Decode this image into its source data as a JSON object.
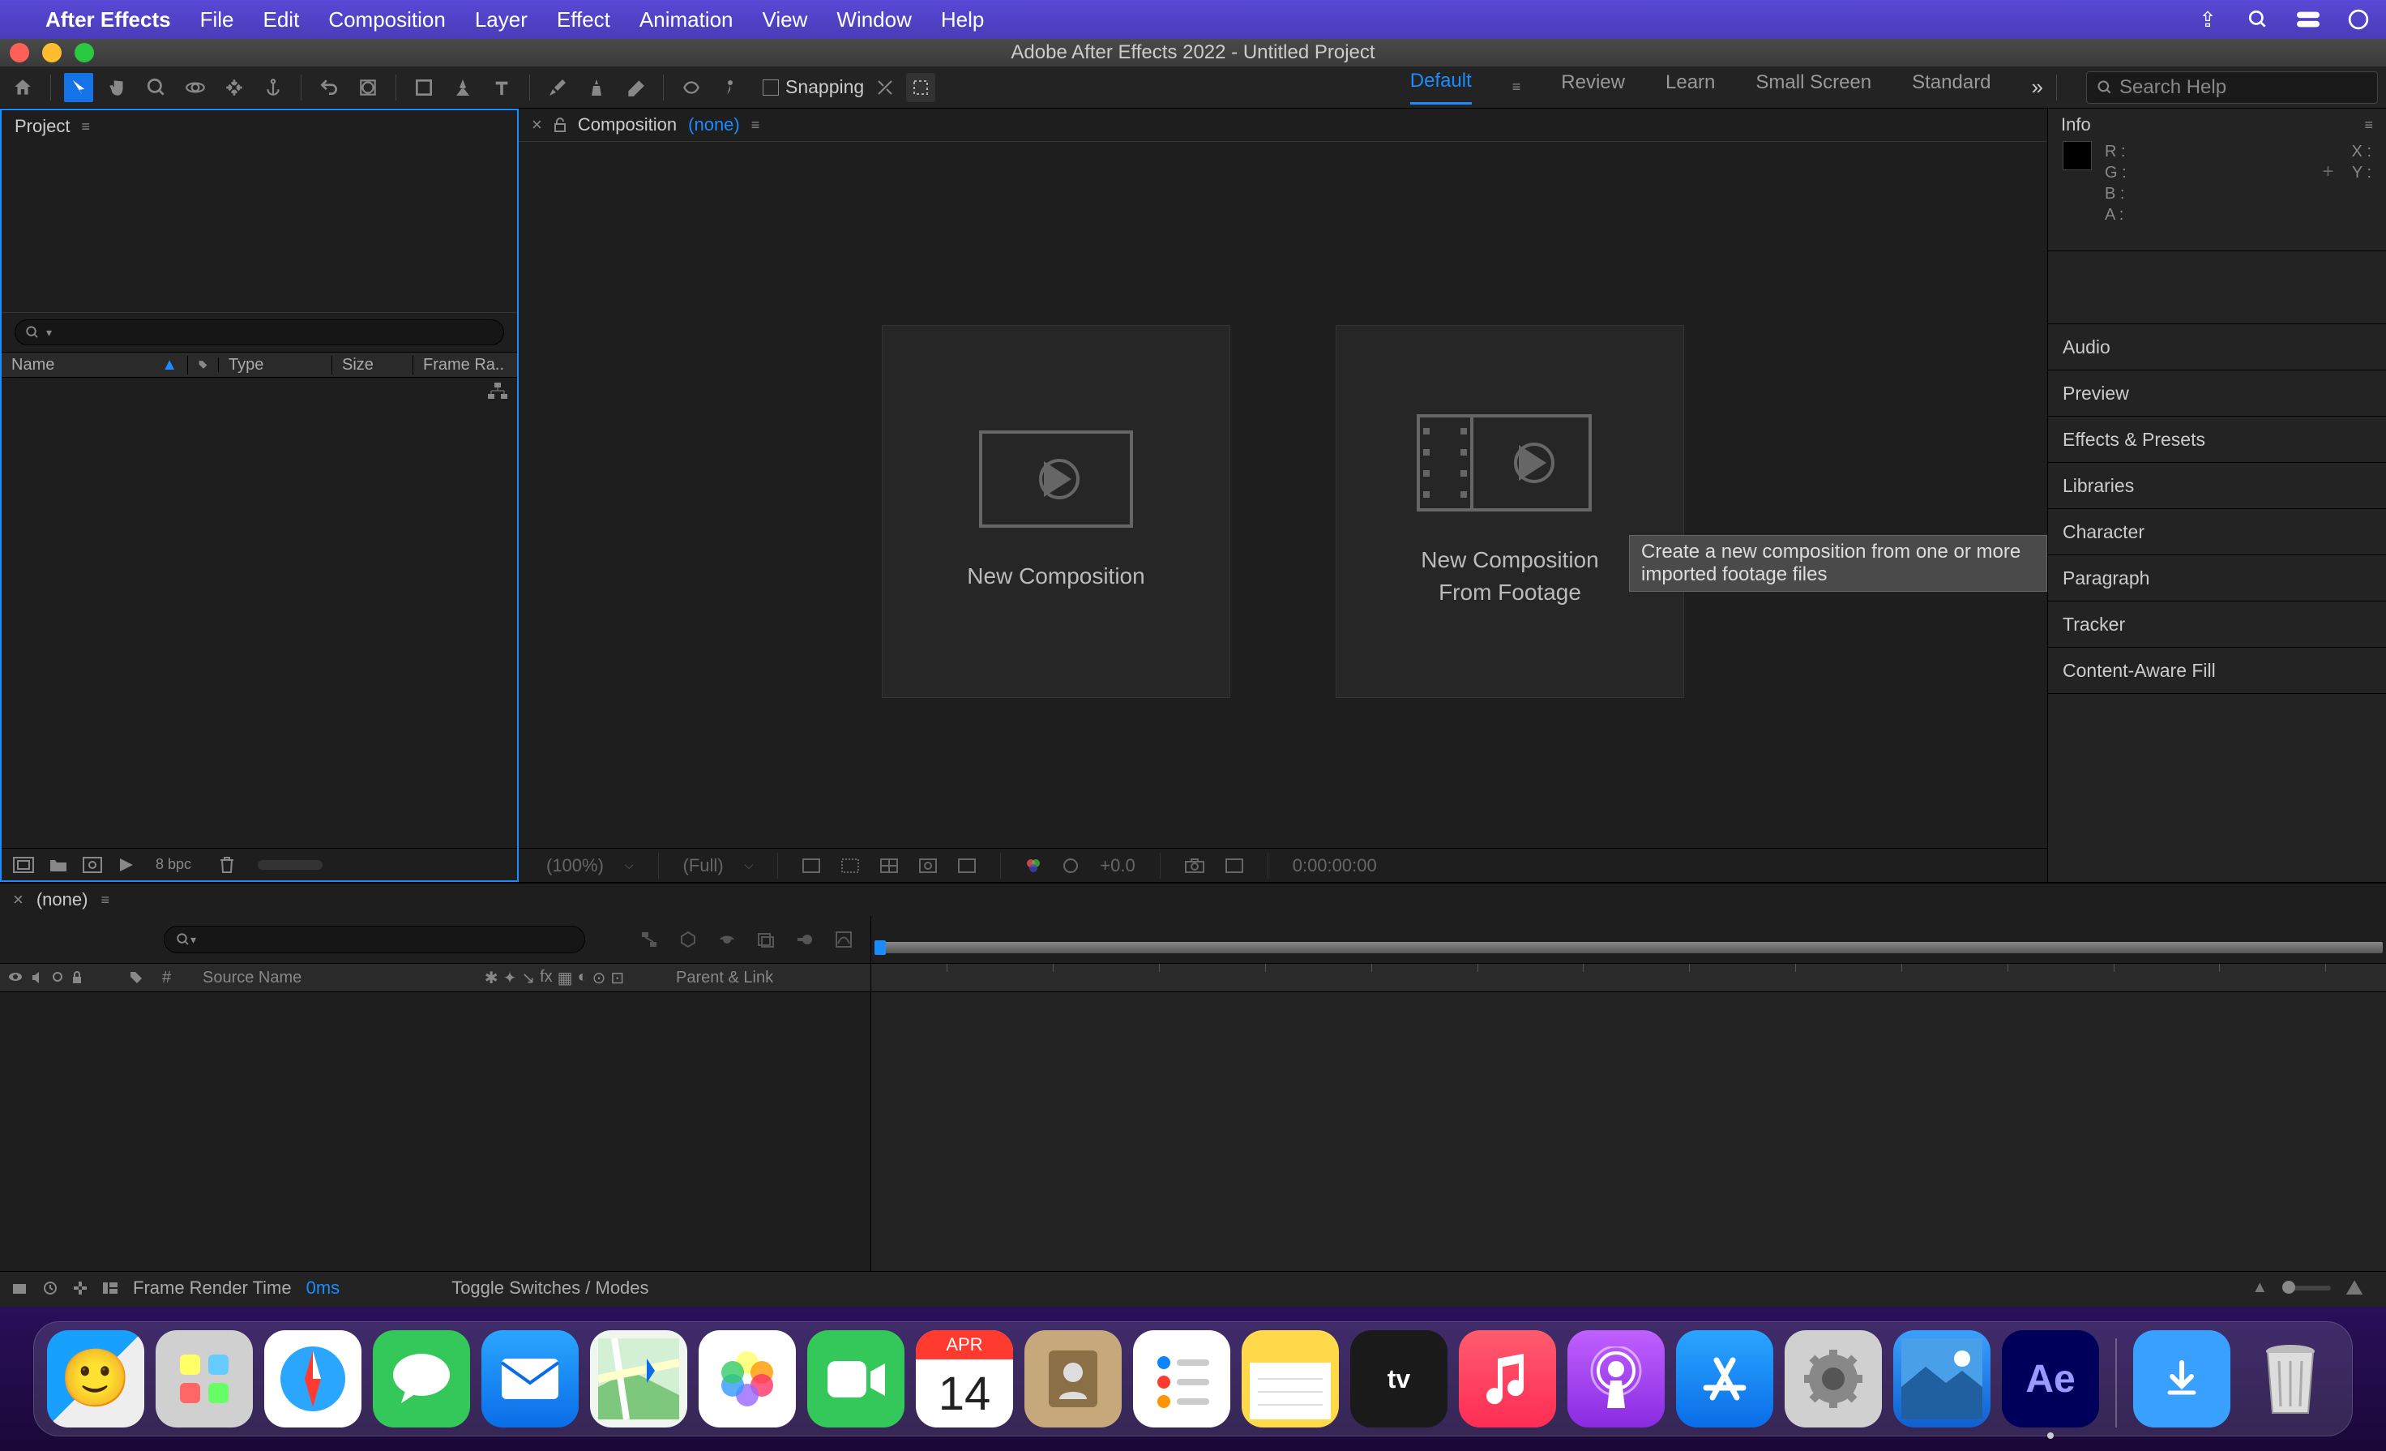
{
  "menubar": {
    "app_name": "After Effects",
    "items": [
      "File",
      "Edit",
      "Composition",
      "Layer",
      "Effect",
      "Animation",
      "View",
      "Window",
      "Help"
    ]
  },
  "window": {
    "title": "Adobe After Effects 2022 - Untitled Project"
  },
  "toolbar": {
    "snapping_label": "Snapping"
  },
  "workspaces": {
    "items": [
      "Default",
      "Review",
      "Learn",
      "Small Screen",
      "Standard"
    ],
    "active": "Default"
  },
  "search_help": {
    "placeholder": "Search Help"
  },
  "project_panel": {
    "title": "Project",
    "columns": {
      "name": "Name",
      "type": "Type",
      "size": "Size",
      "framerate": "Frame Ra.."
    },
    "bpc": "8 bpc"
  },
  "comp_panel": {
    "title": "Composition",
    "none": "(none)",
    "new_comp": "New Composition",
    "new_footage_l1": "New Composition",
    "new_footage_l2": "From Footage",
    "tooltip": "Create a new composition from one or more imported footage files",
    "zoom": "(100%)",
    "res": "(Full)",
    "exposure": "+0.0",
    "timecode": "0:00:00:00"
  },
  "right_panels": {
    "info_title": "Info",
    "r": "R :",
    "g": "G :",
    "b": "B :",
    "a": "A :",
    "x": "X :",
    "y": "Y :",
    "accordions": [
      "Audio",
      "Preview",
      "Effects & Presets",
      "Libraries",
      "Character",
      "Paragraph",
      "Tracker",
      "Content-Aware Fill"
    ]
  },
  "timeline": {
    "none": "(none)",
    "source_name": "Source Name",
    "parent_link": "Parent & Link",
    "num": "#",
    "frt_label": "Frame Render Time",
    "frt_value": "0ms",
    "toggle": "Toggle Switches / Modes"
  },
  "dock": {
    "cal_month": "APR",
    "cal_day": "14",
    "ae": "Ae"
  }
}
